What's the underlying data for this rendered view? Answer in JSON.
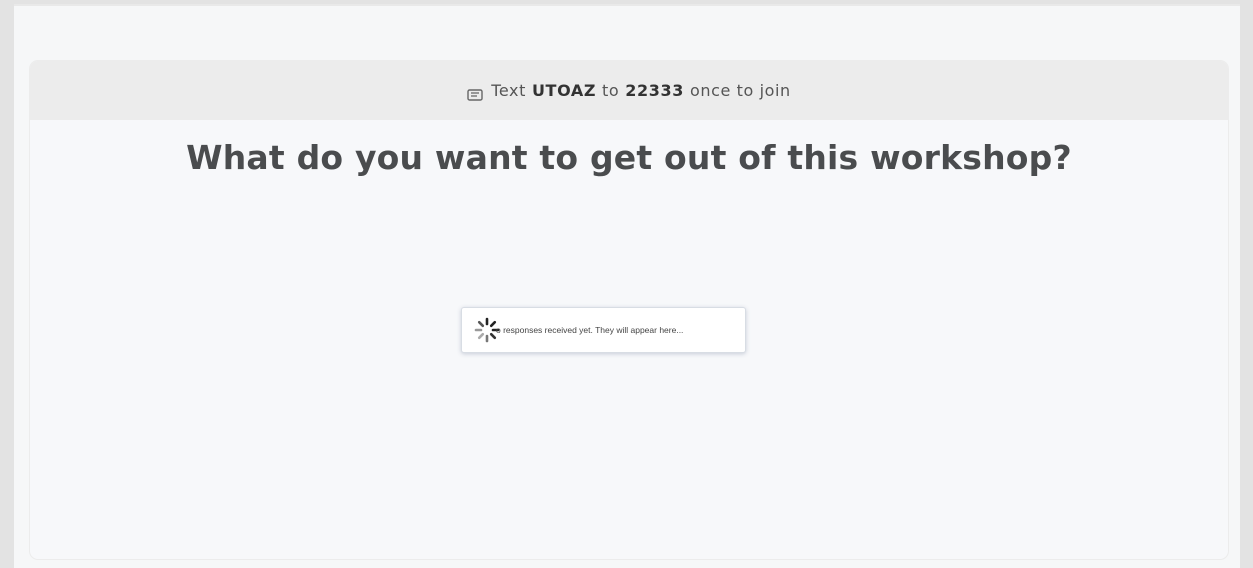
{
  "join_bar": {
    "prefix": "Text",
    "code": "UTOAZ",
    "middle": "to",
    "number": "22333",
    "suffix": "once to join",
    "icon": "phone-icon"
  },
  "question": {
    "title": "What do you want to get out of this workshop?"
  },
  "responses": {
    "empty_message": "o responses received yet. They will appear here...",
    "icon": "loading-spinner-icon"
  }
}
